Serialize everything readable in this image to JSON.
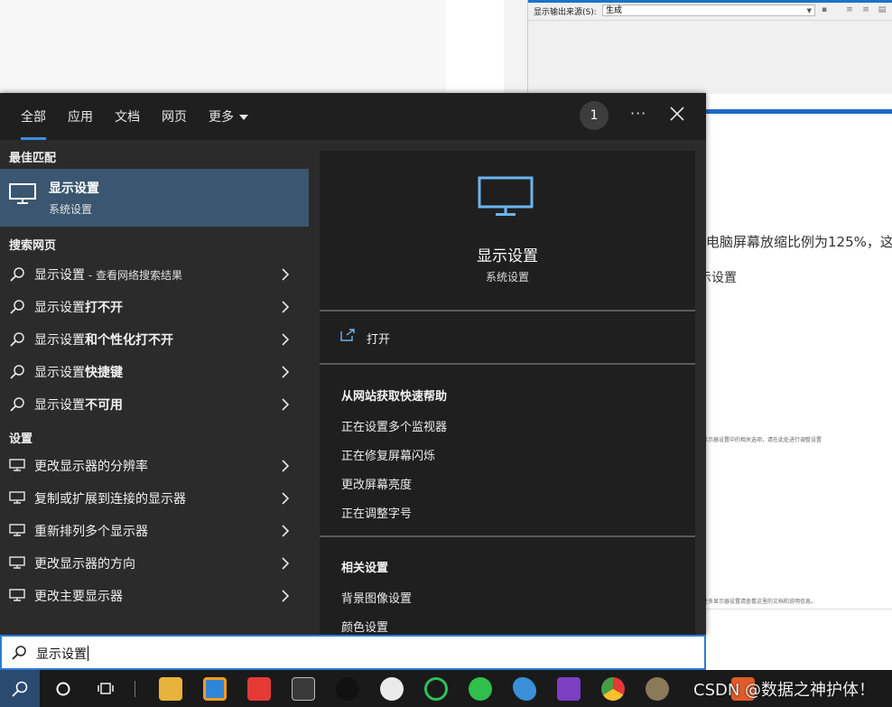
{
  "background": {
    "dialog": {
      "source_label": "显示输出来源(S):",
      "source_value": "生成"
    },
    "document": {
      "line1": "电脑屏幕放缩比例为125%，这",
      "line2": "示设置",
      "tiny1": "显示器设置中的相关选项，请在此处进行调整设置",
      "tiny2": "更多显示器设置请查看这里的文档和说明信息。"
    }
  },
  "tabs": [
    {
      "label": "全部",
      "active": true
    },
    {
      "label": "应用"
    },
    {
      "label": "文档"
    },
    {
      "label": "网页"
    },
    {
      "label": "更多"
    }
  ],
  "header": {
    "badge": "1",
    "more": "···"
  },
  "best_match": {
    "heading": "最佳匹配",
    "title": "显示设置",
    "subtitle": "系统设置"
  },
  "web": {
    "heading": "搜索网页",
    "items": [
      {
        "base": "显示设置",
        "bold": "",
        "suffix": " - 查看网络搜索结果"
      },
      {
        "base": "显示设置",
        "bold": "打不开",
        "suffix": ""
      },
      {
        "base": "显示设置",
        "bold": "和个性化打不开",
        "suffix": ""
      },
      {
        "base": "显示设置",
        "bold": "快捷键",
        "suffix": ""
      },
      {
        "base": "显示设置",
        "bold": "不可用",
        "suffix": ""
      }
    ]
  },
  "settings": {
    "heading": "设置",
    "items": [
      "更改显示器的分辨率",
      "复制或扩展到连接的显示器",
      "重新排列多个显示器",
      "更改显示器的方向",
      "更改主要显示器"
    ]
  },
  "detail": {
    "title": "显示设置",
    "subtitle": "系统设置",
    "open": "打开",
    "help_heading": "从网站获取快速帮助",
    "help_links": [
      "正在设置多个监视器",
      "正在修复屏幕闪烁",
      "更改屏幕亮度",
      "正在调整字号"
    ],
    "related_heading": "相关设置",
    "related_links": [
      "背景图像设置",
      "颜色设置"
    ]
  },
  "search": {
    "query": "显示设置"
  },
  "watermark": "CSDN @数据之神护体！",
  "colors": {
    "accent": "#3a8fe0",
    "best_match_bg": "#3a5670",
    "panel_bg": "#2b2b2b",
    "detail_bg": "#1f1f1f",
    "monitor_icon": "#6cb4f0"
  },
  "taskbar_icons": [
    "search-icon",
    "cortana-icon",
    "task-view-icon",
    "file-explorer-icon",
    "vmware-icon",
    "xmind-icon",
    "snipping-icon",
    "qq-icon",
    "chat-icon",
    "refresh-app-icon",
    "wechat-icon",
    "dolphin-icon",
    "visual-studio-icon",
    "chrome-icon",
    "avatar-icon",
    "app-icon"
  ]
}
